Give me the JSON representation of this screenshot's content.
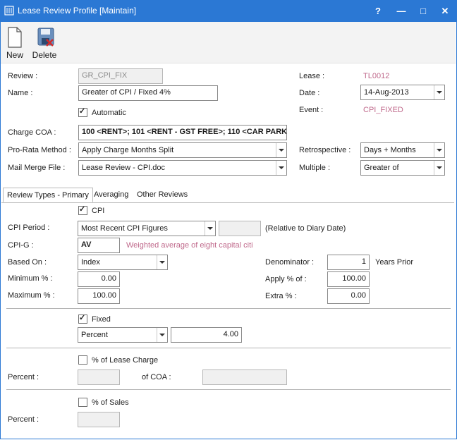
{
  "window": {
    "title": "Lease Review Profile [Maintain]",
    "help_label": "?",
    "minimize_label": "—",
    "maximize_label": "□",
    "close_label": "✕"
  },
  "toolbar": {
    "new_label": "New",
    "delete_label": "Delete"
  },
  "form": {
    "review_label": "Review :",
    "review_value": "GR_CPI_FIX",
    "name_label": "Name :",
    "name_value": "Greater of CPI / Fixed 4%",
    "automatic_label": "Automatic",
    "automatic_checked": true,
    "charge_coa_label": "Charge COA :",
    "charge_coa_value": "100 <RENT>; 101 <RENT - GST FREE>; 110 <CAR PARKI",
    "prorata_label": "Pro-Rata Method :",
    "prorata_value": "Apply Charge Months Split",
    "mailmerge_label": "Mail Merge File :",
    "mailmerge_value": "Lease Review - CPI.doc",
    "lease_label": "Lease :",
    "lease_value": "TL0012",
    "date_label": "Date :",
    "date_value": "14-Aug-2013",
    "event_label": "Event :",
    "event_value": "CPI_FIXED",
    "retro_label": "Retrospective :",
    "retro_value": "Days + Months",
    "multiple_label": "Multiple :",
    "multiple_value": "Greater of"
  },
  "tabs": [
    {
      "label": "Review Types - Primary"
    },
    {
      "label": "Averaging"
    },
    {
      "label": "Other Reviews"
    }
  ],
  "cpi": {
    "label": "CPI",
    "checked": true,
    "period_label": "CPI Period :",
    "period_value": "Most Recent CPI Figures",
    "period_note": "(Relative to Diary Date)",
    "cpig_label": "CPI-G :",
    "cpig_value": "AV",
    "cpig_desc": "Weighted average of eight capital citi",
    "based_on_label": "Based On :",
    "based_on_value": "Index",
    "minimum_label": "Minimum % :",
    "minimum_value": "0.00",
    "maximum_label": "Maximum % :",
    "maximum_value": "100.00",
    "denominator_label": "Denominator :",
    "denominator_value": "1",
    "years_prior_label": "Years Prior",
    "apply_label": "Apply % of :",
    "apply_value": "100.00",
    "extra_label": "Extra % :",
    "extra_value": "0.00"
  },
  "fixed": {
    "label": "Fixed",
    "checked": true,
    "type_value": "Percent",
    "amount_value": "4.00"
  },
  "lease_charge": {
    "label": "% of Lease Charge",
    "checked": false,
    "percent_label": "Percent :",
    "of_coa_label": "of COA :"
  },
  "sales": {
    "label": "% of Sales",
    "checked": false,
    "percent_label": "Percent :"
  }
}
